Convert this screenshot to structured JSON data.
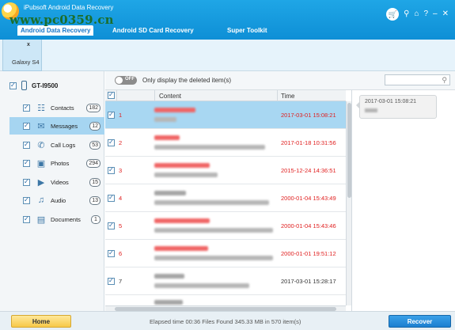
{
  "app": {
    "title": "iPubsoft Android Data Recovery",
    "watermark": "www.pc0359.cn",
    "accent_color": "#1890d8",
    "deleted_color": "#e02020"
  },
  "tabs": [
    {
      "label": "Android Data Recovery",
      "active": true
    },
    {
      "label": "Android SD Card Recovery",
      "active": false
    },
    {
      "label": "Super Toolkit",
      "active": false
    }
  ],
  "window_icons": [
    "cart-icon",
    "key-icon",
    "home-icon",
    "help-icon",
    "minimize-icon",
    "close-icon"
  ],
  "window_glyphs": {
    "key": "⚲",
    "home": "⌂",
    "help": "?",
    "minimize": "–",
    "close": "✕",
    "cart": "🛒"
  },
  "device_tab": {
    "label": "Galaxy S4",
    "close": "x"
  },
  "sidebar": {
    "device_name": "GT-I9500",
    "categories": [
      {
        "label": "Contacts",
        "count": "182",
        "icon": "contacts-icon",
        "glyph": "☷",
        "active": false
      },
      {
        "label": "Messages",
        "count": "12",
        "icon": "message-icon",
        "glyph": "✉",
        "active": true
      },
      {
        "label": "Call Logs",
        "count": "53",
        "icon": "phone-call-icon",
        "glyph": "✆",
        "active": false
      },
      {
        "label": "Photos",
        "count": "294",
        "icon": "photo-icon",
        "glyph": "▣",
        "active": false
      },
      {
        "label": "Videos",
        "count": "15",
        "icon": "video-icon",
        "glyph": "▶",
        "active": false
      },
      {
        "label": "Audio",
        "count": "13",
        "icon": "audio-icon",
        "glyph": "♫",
        "active": false
      },
      {
        "label": "Documents",
        "count": "1",
        "icon": "document-icon",
        "glyph": "▤",
        "active": false
      }
    ]
  },
  "filter": {
    "toggle_state": "OFF",
    "label": "Only display the deleted item(s)",
    "search_placeholder": ""
  },
  "table": {
    "columns": [
      "Content",
      "Time"
    ],
    "rows": [
      {
        "num": "1",
        "time": "2017-03-01 15:08:21",
        "deleted": true,
        "selected": true
      },
      {
        "num": "2",
        "time": "2017-01-18 10:31:56",
        "deleted": true,
        "selected": false
      },
      {
        "num": "3",
        "time": "2015-12-24 14:36:51",
        "deleted": true,
        "selected": false
      },
      {
        "num": "4",
        "time": "2000-01-04 15:43:49",
        "deleted": true,
        "selected": false
      },
      {
        "num": "5",
        "time": "2000-01-04 15:43:46",
        "deleted": true,
        "selected": false
      },
      {
        "num": "6",
        "time": "2000-01-01 19:51:12",
        "deleted": true,
        "selected": false
      },
      {
        "num": "7",
        "time": "2017-03-01 15:28:17",
        "deleted": false,
        "selected": false
      }
    ]
  },
  "preview": {
    "time": "2017-03-01 15:08:21"
  },
  "footer": {
    "home_label": "Home",
    "status": "Elapsed time 00:36   Files Found 345.33 MB in 570 item(s)",
    "recover_label": "Recover"
  }
}
